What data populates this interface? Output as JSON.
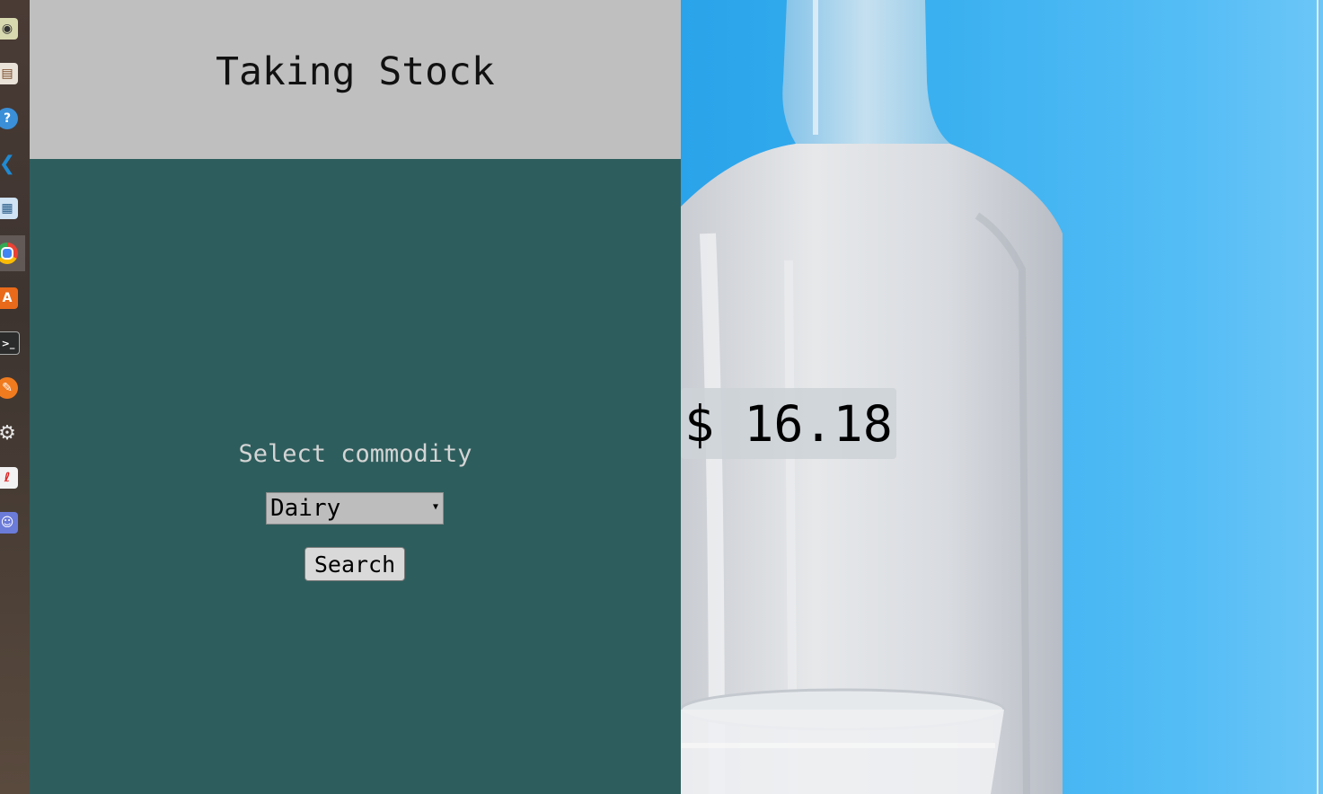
{
  "header": {
    "title": "Taking Stock"
  },
  "form": {
    "label": "Select commodity",
    "selected_commodity": "Dairy",
    "search_label": "Search"
  },
  "result": {
    "price": "$ 16.18"
  },
  "dock": {
    "items": [
      {
        "icon": "disc-icon",
        "color": "#d9d9b0",
        "glyph": "◉"
      },
      {
        "icon": "file-manager-icon",
        "color": "#e9e2d8",
        "glyph": "▤"
      },
      {
        "icon": "help-icon",
        "color": "#3a8fd8",
        "glyph": "?"
      },
      {
        "icon": "vscode-icon",
        "color": "#1f8ad2",
        "glyph": "❮"
      },
      {
        "icon": "document-viewer-icon",
        "color": "#cfe3f4",
        "glyph": "▦"
      },
      {
        "icon": "chrome-icon",
        "color": "#e94235",
        "glyph": "◍"
      },
      {
        "icon": "software-center-icon",
        "color": "#e86a1a",
        "glyph": "A"
      },
      {
        "icon": "terminal-icon",
        "color": "#2b2b2b",
        "glyph": ">"
      },
      {
        "icon": "draw-icon",
        "color": "#f07b1f",
        "glyph": "✎"
      },
      {
        "icon": "settings-icon",
        "color": "#d74a1f",
        "glyph": "⚙"
      },
      {
        "icon": "document-editor-icon",
        "color": "#f2f2f2",
        "glyph": "ℓ"
      },
      {
        "icon": "discord-icon",
        "color": "#6b7bd8",
        "glyph": "☺"
      }
    ]
  },
  "colors": {
    "header_bg": "#bfbfbf",
    "panel_bg": "#2e5d5d",
    "sky_blue": "#3ab0f0"
  }
}
